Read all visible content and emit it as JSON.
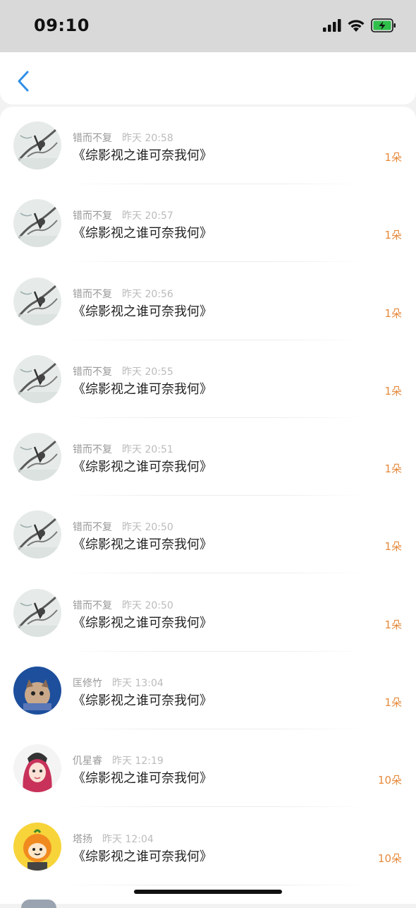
{
  "status_bar": {
    "time": "09:10",
    "icons": [
      "signal-icon",
      "wifi-icon",
      "battery-charging-icon"
    ],
    "battery_color": "#2fbf4a"
  },
  "nav": {
    "back_icon": "chevron-left-icon",
    "accent": "#2f8fe8"
  },
  "records": [
    {
      "name": "错而不复",
      "time": "昨天 20:58",
      "title": "《综影视之谁可奈我何》",
      "amount": "1朵",
      "avatar": "ink-painting-avatar"
    },
    {
      "name": "错而不复",
      "time": "昨天 20:57",
      "title": "《综影视之谁可奈我何》",
      "amount": "1朵",
      "avatar": "ink-painting-avatar"
    },
    {
      "name": "错而不复",
      "time": "昨天 20:56",
      "title": "《综影视之谁可奈我何》",
      "amount": "1朵",
      "avatar": "ink-painting-avatar"
    },
    {
      "name": "错而不复",
      "time": "昨天 20:55",
      "title": "《综影视之谁可奈我何》",
      "amount": "1朵",
      "avatar": "ink-painting-avatar"
    },
    {
      "name": "错而不复",
      "time": "昨天 20:51",
      "title": "《综影视之谁可奈我何》",
      "amount": "1朵",
      "avatar": "ink-painting-avatar"
    },
    {
      "name": "错而不复",
      "time": "昨天 20:50",
      "title": "《综影视之谁可奈我何》",
      "amount": "1朵",
      "avatar": "ink-painting-avatar"
    },
    {
      "name": "错而不复",
      "time": "昨天 20:50",
      "title": "《综影视之谁可奈我何》",
      "amount": "1朵",
      "avatar": "ink-painting-avatar"
    },
    {
      "name": "匡修竹",
      "time": "昨天 13:04",
      "title": "《综影视之谁可奈我何》",
      "amount": "1朵",
      "avatar": "blue-cat-avatar"
    },
    {
      "name": "仉星睿",
      "time": "昨天 12:19",
      "title": "《综影视之谁可奈我何》",
      "amount": "10朵",
      "avatar": "red-hair-girl-avatar"
    },
    {
      "name": "塔扬",
      "time": "昨天 12:04",
      "title": "《综影视之谁可奈我何》",
      "amount": "10朵",
      "avatar": "orange-cartoon-avatar"
    }
  ],
  "colors": {
    "amount": "#e58a3c",
    "name": "#999999",
    "title": "#222222"
  }
}
